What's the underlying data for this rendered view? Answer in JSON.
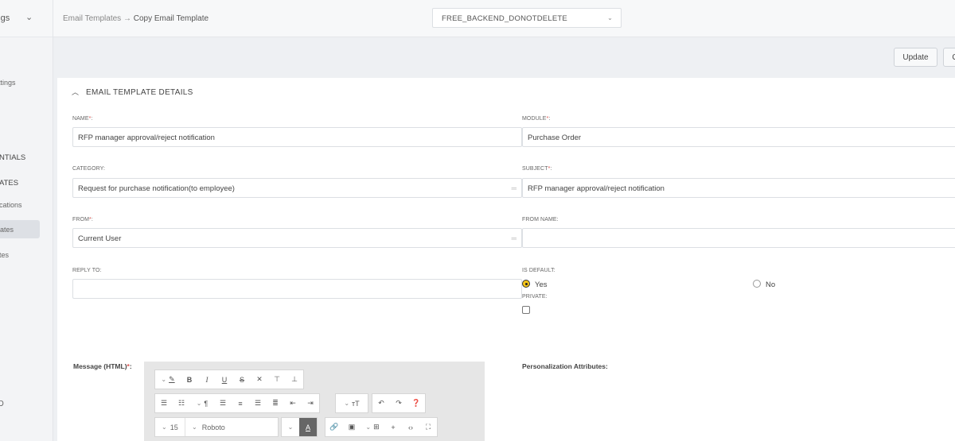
{
  "sidebar": {
    "top_label": "ttings",
    "items": [
      {
        "label": "ttings"
      },
      {
        "label": "NTIALS"
      },
      {
        "label": "ATES"
      },
      {
        "label": "cations"
      },
      {
        "label": "ates"
      },
      {
        "label": "tes"
      },
      {
        "label": "O"
      }
    ]
  },
  "header": {
    "breadcrumb_parent": "Email Templates",
    "breadcrumb_sep": "→",
    "breadcrumb_current": "Copy Email Template",
    "org_value": "FREE_BACKEND_DONOTDELETE"
  },
  "actions": {
    "update_label": "Update",
    "second_label": "C"
  },
  "section": {
    "title": "EMAIL TEMPLATE DETAILS"
  },
  "form": {
    "name_label": "NAME",
    "name_value": "RFP manager approval/reject notification",
    "module_label": "MODULE",
    "module_value": "Purchase Order",
    "category_label": "CATEGORY:",
    "category_value": "Request for purchase notification(to employee)",
    "subject_label": "SUBJECT",
    "subject_value": "RFP manager approval/reject notification",
    "from_label": "FROM",
    "from_value": "Current User",
    "from_name_label": "FROM NAME:",
    "from_name_value": "",
    "reply_to_label": "REPLY TO:",
    "reply_to_value": "",
    "is_default_label": "IS DEFAULT:",
    "yes_label": "Yes",
    "no_label": "No",
    "private_label": "PRIVATE:",
    "required_mark": "*",
    "colon": ":",
    "message_label": "Message (HTML)",
    "message_suffix": ":",
    "personalization_label": "Personalization Attributes:"
  },
  "editor": {
    "font_size": "15",
    "font_family": "Roboto"
  }
}
